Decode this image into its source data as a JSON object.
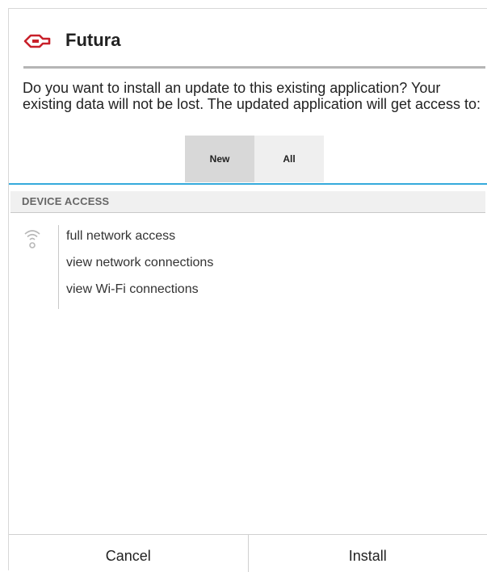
{
  "dialog": {
    "title": "Futura",
    "message": "Do you want to install an update to this existing application? Your existing data will not be lost. The updated application will get access to:"
  },
  "tabs": [
    {
      "label": "New",
      "selected": true
    },
    {
      "label": "All",
      "selected": false
    }
  ],
  "section": {
    "header": "DEVICE ACCESS",
    "icon": "wifi-icon",
    "permissions": [
      "full network access",
      "view network connections",
      "view Wi-Fi connections"
    ]
  },
  "buttons": {
    "cancel_label": "Cancel",
    "install_label": "Install"
  },
  "colors": {
    "accent": "#35aadc",
    "app_icon": "#c8202a"
  }
}
